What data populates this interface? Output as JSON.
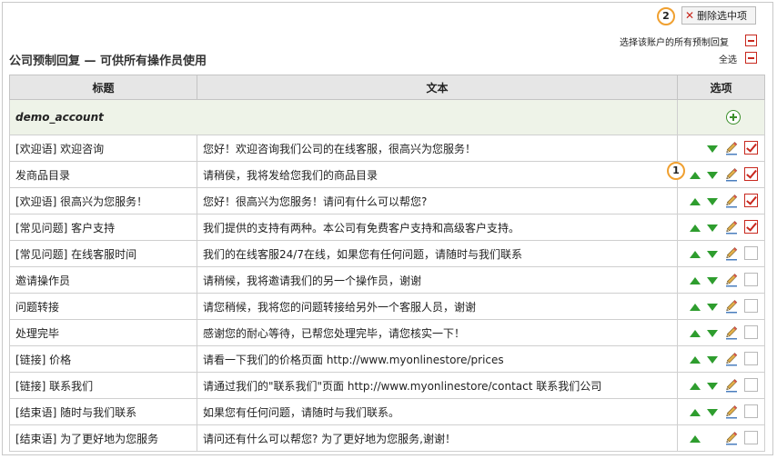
{
  "toolbar": {
    "badge_2": "2",
    "delete_selected_label": "删除选中项",
    "select_account_label": "选择该账户的所有预制回复",
    "select_all_label": "全选"
  },
  "section": {
    "title": "公司预制回复 — 可供所有操作员使用"
  },
  "table": {
    "headers": {
      "title": "标题",
      "text": "文本",
      "options": "选项"
    },
    "account_name": "demo_account",
    "badge_1": "1",
    "rows": [
      {
        "title": "[欢迎语] 欢迎咨询",
        "text": "您好！欢迎咨询我们公司的在线客服，很高兴为您服务！",
        "checked": true
      },
      {
        "title": "发商品目录",
        "text": "请稍侯，我将发给您我们的商品目录",
        "checked": true
      },
      {
        "title": "[欢迎语] 很高兴为您服务！",
        "text": "您好！很高兴为您服务！请问有什么可以帮您?",
        "checked": true
      },
      {
        "title": "[常见问题] 客户支持",
        "text": "我们提供的支持有两种。本公司有免费客户支持和高级客户支持。",
        "checked": true
      },
      {
        "title": "[常见问题] 在线客服时间",
        "text": "我们的在线客服24/7在线，如果您有任何问题，请随时与我们联系",
        "checked": false
      },
      {
        "title": "邀请操作员",
        "text": "请稍候，我将邀请我们的另一个操作员，谢谢",
        "checked": false
      },
      {
        "title": "问题转接",
        "text": "请您稍候，我将您的问题转接给另外一个客服人员，谢谢",
        "checked": false
      },
      {
        "title": "处理完毕",
        "text": "感谢您的耐心等待，已帮您处理完毕，请您核实一下！",
        "checked": false
      },
      {
        "title": "[链接] 价格",
        "text": "请看一下我们的价格页面 http://www.myonlinestore/prices",
        "checked": false
      },
      {
        "title": "[链接] 联系我们",
        "text": "请通过我们的\"联系我们\"页面 http://www.myonlinestore/contact 联系我们公司",
        "checked": false
      },
      {
        "title": "[结束语] 随时与我们联系",
        "text": "如果您有任何问题，请随时与我们联系。",
        "checked": false
      },
      {
        "title": "[结束语] 为了更好地为您服务",
        "text": "请问还有什么可以帮您? 为了更好地为您服务,谢谢！",
        "checked": false
      }
    ]
  },
  "icons": {
    "move_up": "arrow-up-icon",
    "move_down": "arrow-down-icon",
    "edit": "pencil-icon",
    "add": "plus-circle-icon",
    "deselect": "minus-box-icon",
    "delete": "x-icon"
  },
  "colors": {
    "accent_green": "#2e9d2e",
    "accent_red": "#c8281e",
    "badge_orange": "#f0a030"
  }
}
